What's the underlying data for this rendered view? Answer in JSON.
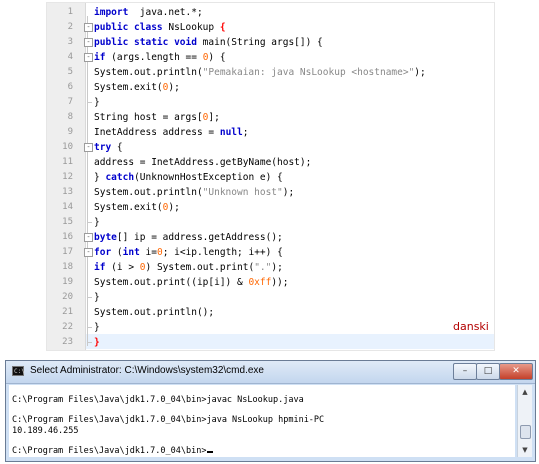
{
  "editor": {
    "line_numbers": [
      "1",
      "2",
      "3",
      "4",
      "5",
      "6",
      "7",
      "8",
      "9",
      "10",
      "11",
      "12",
      "13",
      "14",
      "15",
      "16",
      "17",
      "18",
      "19",
      "20",
      "21",
      "22",
      "23"
    ],
    "fold_markers": [
      "-",
      "-",
      "-",
      "-",
      "-",
      "-"
    ],
    "signature": "danski"
  },
  "console": {
    "title": "Select Administrator: C:\\Windows\\system32\\cmd.exe",
    "icon_label": "C:\\",
    "buttons": {
      "minimize": "–",
      "maximize": "□",
      "close": "✕"
    },
    "lines": [
      "C:\\Program Files\\Java\\jdk1.7.0_04\\bin>javac NsLookup.java",
      "C:\\Program Files\\Java\\jdk1.7.0_04\\bin>java NsLookup hpmini-PC",
      "10.189.46.255",
      "C:\\Program Files\\Java\\jdk1.7.0_04\\bin>"
    ],
    "scroll_up": "▲",
    "scroll_down": "▼"
  },
  "colors": {
    "keyword": "#0000cc",
    "string": "#888888",
    "number": "#ff6600",
    "signature": "#b30000",
    "current_line": "#e8f2fe"
  }
}
